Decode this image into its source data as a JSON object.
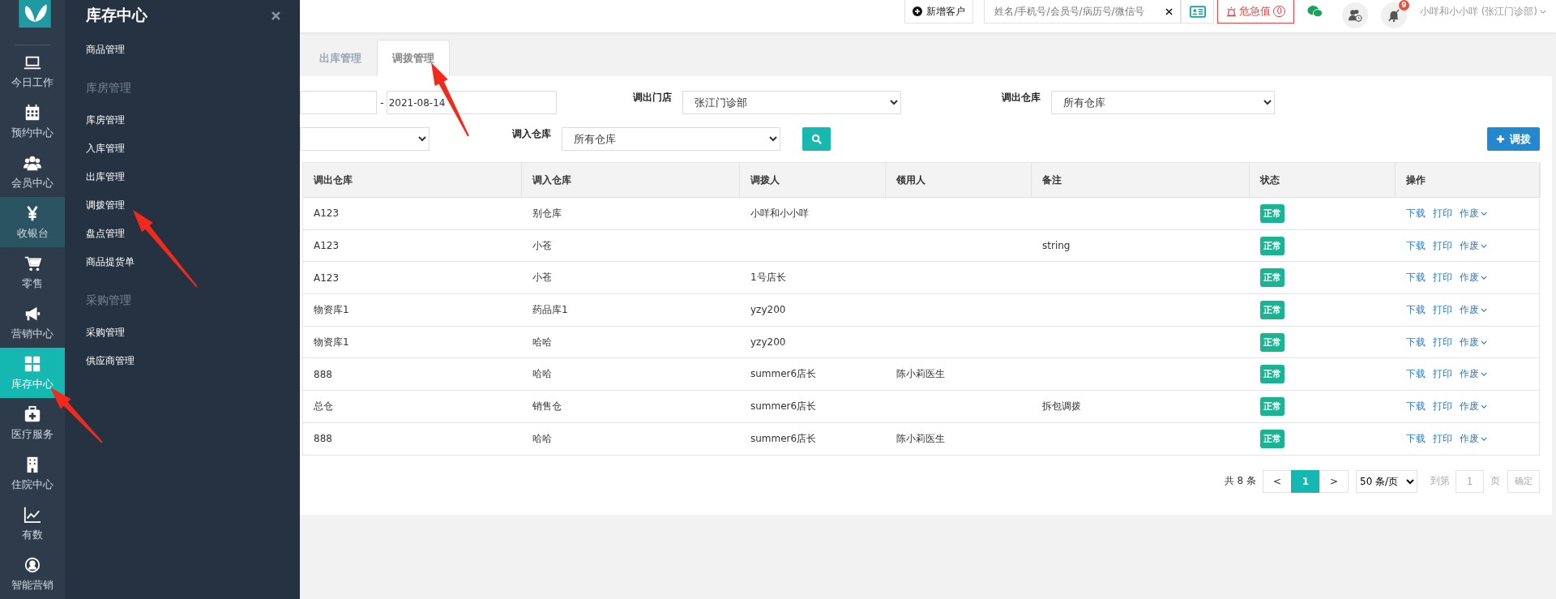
{
  "sidebar": {
    "items": [
      {
        "label": "今日工作",
        "selected": false,
        "hovered": false
      },
      {
        "label": "预约中心",
        "selected": false,
        "hovered": false
      },
      {
        "label": "会员中心",
        "selected": false,
        "hovered": false
      },
      {
        "label": "收银台",
        "selected": false,
        "hovered": true
      },
      {
        "label": "零售",
        "selected": false,
        "hovered": false
      },
      {
        "label": "营销中心",
        "selected": false,
        "hovered": false
      },
      {
        "label": "库存中心",
        "selected": true,
        "hovered": false
      },
      {
        "label": "医疗服务",
        "selected": false,
        "hovered": false
      },
      {
        "label": "住院中心",
        "selected": false,
        "hovered": false
      },
      {
        "label": "有数",
        "selected": false,
        "hovered": false
      },
      {
        "label": "智能营销",
        "selected": false,
        "hovered": false
      }
    ]
  },
  "flyout": {
    "title": "库存中心",
    "groups": [
      {
        "items": [
          "商品管理"
        ]
      },
      {
        "heading": "库房管理",
        "items": [
          "库房管理",
          "入库管理",
          "出库管理",
          "调拨管理",
          "盘点管理",
          "商品提货单"
        ]
      },
      {
        "heading": "采购管理",
        "items": [
          "采购管理",
          "供应商管理"
        ]
      }
    ]
  },
  "topbar": {
    "add_customer": "新增客户",
    "search": {
      "placeholder": "姓名/手机号/会员号/病历号/微信号"
    },
    "alert": {
      "label": "危急值",
      "count": "0"
    },
    "notification_badge": "9",
    "user": "小咩和小小咩 (张江门诊部)"
  },
  "tabs": [
    {
      "label": "出库管理",
      "selected": false
    },
    {
      "label": "调拨管理",
      "selected": true
    }
  ],
  "filters": {
    "date_separator": "-",
    "date_to": "2021-08-14",
    "fields": [
      {
        "label": "调出门店",
        "value": "张江门诊部"
      },
      {
        "label": "调出仓库",
        "value": "所有仓库"
      },
      {
        "label": "调入仓库",
        "value": "所有仓库"
      }
    ],
    "add_button": "调拨"
  },
  "table": {
    "columns": [
      "调出仓库",
      "调入仓库",
      "调拨人",
      "领用人",
      "备注",
      "状态",
      "操作"
    ],
    "rows": [
      {
        "from": "A123",
        "to": "别仓库",
        "transferor": "小咩和小小咩",
        "status": "正常",
        "actions": [
          {
            "label": "下载",
            "dropdown": false
          },
          {
            "label": "打印",
            "dropdown": false
          },
          {
            "label": "作废",
            "dropdown": true
          }
        ]
      },
      {
        "from": "A123",
        "to": "小苍",
        "note": "string",
        "status": "正常",
        "actions": [
          {
            "label": "下载",
            "dropdown": false
          },
          {
            "label": "打印",
            "dropdown": false
          },
          {
            "label": "作废",
            "dropdown": true
          }
        ]
      },
      {
        "from": "A123",
        "to": "小苍",
        "transferor": "1号店长",
        "status": "正常",
        "actions": [
          {
            "label": "下载",
            "dropdown": false
          },
          {
            "label": "打印",
            "dropdown": false
          },
          {
            "label": "作废",
            "dropdown": true
          }
        ]
      },
      {
        "from": "物资库1",
        "to": "药品库1",
        "transferor": "yzy200",
        "status": "正常",
        "actions": [
          {
            "label": "下载",
            "dropdown": false
          },
          {
            "label": "打印",
            "dropdown": false
          },
          {
            "label": "作废",
            "dropdown": true
          }
        ]
      },
      {
        "from": "物资库1",
        "to": "哈哈",
        "transferor": "yzy200",
        "status": "正常",
        "actions": [
          {
            "label": "下载",
            "dropdown": false
          },
          {
            "label": "打印",
            "dropdown": false
          },
          {
            "label": "作废",
            "dropdown": true
          }
        ]
      },
      {
        "from": "888",
        "to": "哈哈",
        "transferor": "summer6店长",
        "receiver": "陈小莉医生",
        "status": "正常",
        "actions": [
          {
            "label": "下载",
            "dropdown": false
          },
          {
            "label": "打印",
            "dropdown": false
          },
          {
            "label": "作废",
            "dropdown": true
          }
        ]
      },
      {
        "from": "总仓",
        "to": "销售仓",
        "transferor": "summer6店长",
        "note": "拆包调拨",
        "status": "正常",
        "actions": [
          {
            "label": "下载",
            "dropdown": false
          },
          {
            "label": "打印",
            "dropdown": false
          },
          {
            "label": "作废",
            "dropdown": true
          }
        ]
      },
      {
        "from": "888",
        "to": "哈哈",
        "transferor": "summer6店长",
        "receiver": "陈小莉医生",
        "status": "正常",
        "actions": [
          {
            "label": "下载",
            "dropdown": false
          },
          {
            "label": "打印",
            "dropdown": false
          },
          {
            "label": "作废",
            "dropdown": true
          }
        ]
      }
    ]
  },
  "pagination": {
    "total": "共 8 条",
    "prev": "<",
    "pages": [
      {
        "label": "1",
        "selected": true
      }
    ],
    "next": ">",
    "page_size": "50 条/页",
    "goto_label": "到第",
    "goto_value": "1",
    "page_unit": "页",
    "confirm": "确定"
  }
}
